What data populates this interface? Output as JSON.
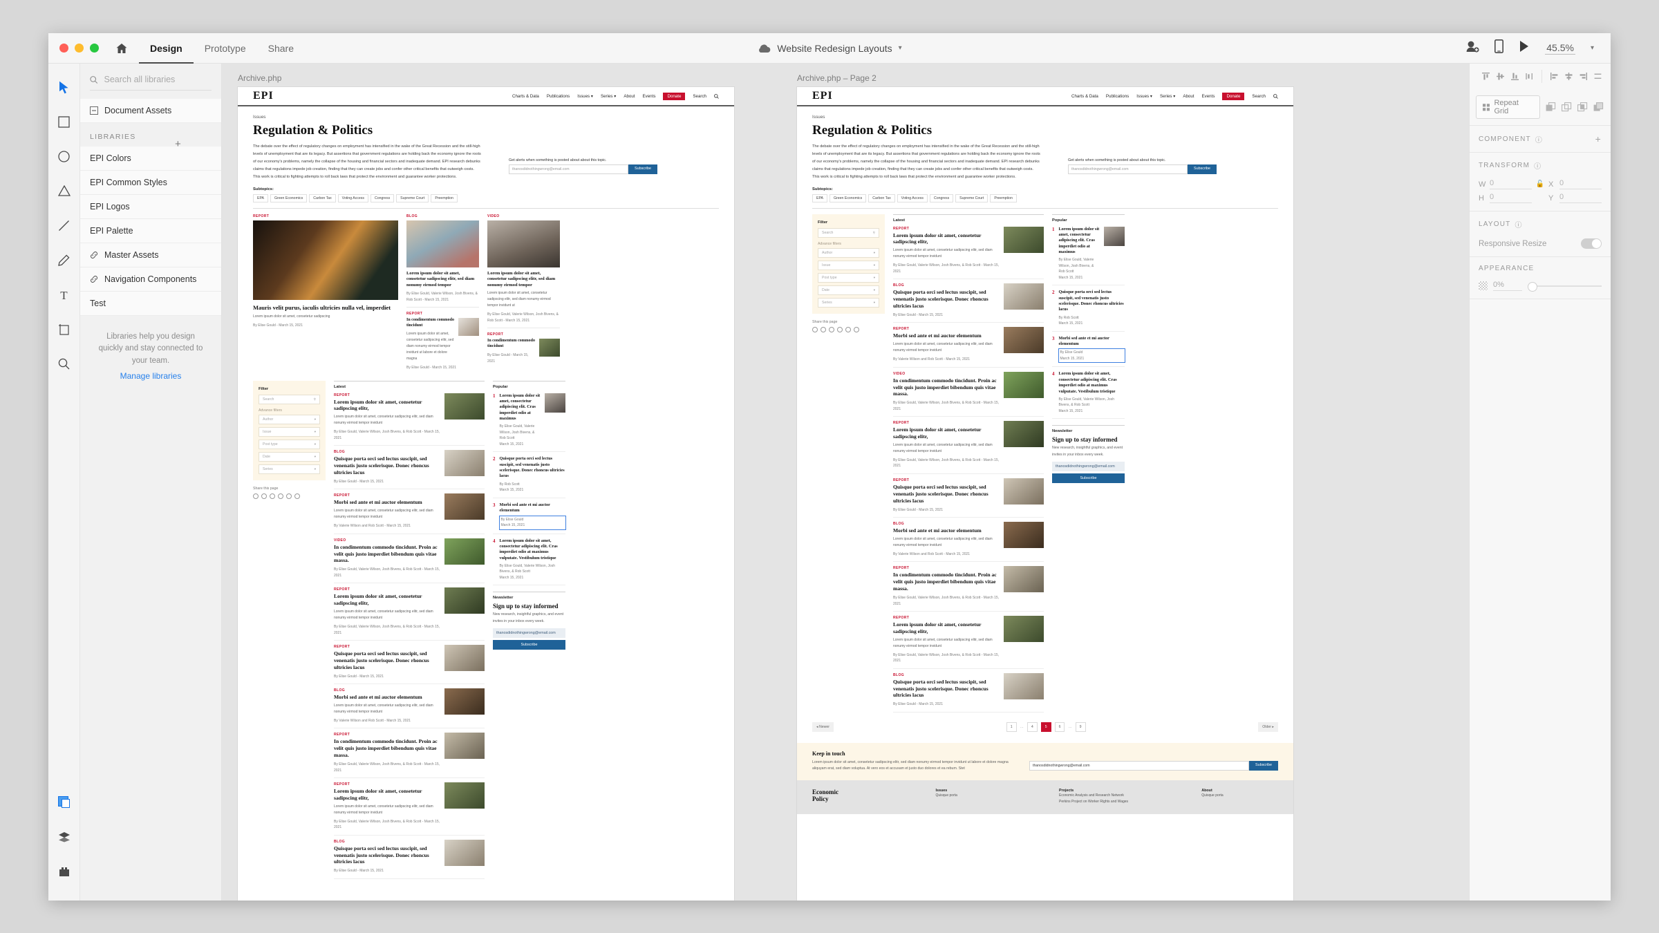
{
  "app": {
    "tabs": [
      {
        "label": "Design",
        "active": true
      },
      {
        "label": "Prototype",
        "active": false
      },
      {
        "label": "Share",
        "active": false
      }
    ],
    "document_title": "Website Redesign Layouts",
    "zoom": "45.5%",
    "home_icon": "home-icon",
    "cloud_icon": "cloud-icon",
    "share_user_icon": "add-user-icon",
    "device_preview_icon": "mobile-preview-icon",
    "play_icon": "play-icon",
    "chevron_icon": "chevron-down-icon"
  },
  "toolrail": {
    "tools": [
      {
        "name": "select-tool",
        "icon": "cursor-icon",
        "active": true
      },
      {
        "name": "rectangle-tool",
        "icon": "rectangle-icon"
      },
      {
        "name": "ellipse-tool",
        "icon": "ellipse-icon"
      },
      {
        "name": "polygon-tool",
        "icon": "triangle-icon"
      },
      {
        "name": "line-tool",
        "icon": "line-icon"
      },
      {
        "name": "pen-tool",
        "icon": "pen-icon"
      },
      {
        "name": "text-tool",
        "icon": "text-icon"
      },
      {
        "name": "artboard-tool",
        "icon": "artboard-icon"
      },
      {
        "name": "zoom-tool",
        "icon": "magnifier-icon"
      }
    ],
    "bottom": [
      {
        "name": "assets-panel",
        "icon": "assets-icon",
        "active": true
      },
      {
        "name": "layers-panel",
        "icon": "layers-icon"
      },
      {
        "name": "plugins-panel",
        "icon": "plugins-icon"
      }
    ]
  },
  "libraries": {
    "search_placeholder": "Search all libraries",
    "search_value": "",
    "document_assets": "Document Assets",
    "section_title": "LIBRARIES",
    "items": [
      {
        "label": "EPI Colors",
        "linked": false
      },
      {
        "label": "EPI Common Styles",
        "linked": false
      },
      {
        "label": "EPI Logos",
        "linked": false
      },
      {
        "label": "EPI Palette",
        "linked": false
      },
      {
        "label": "Master Assets",
        "linked": true
      },
      {
        "label": "Navigation Components",
        "linked": true
      },
      {
        "label": "Test",
        "linked": false
      }
    ],
    "hint": "Libraries help you design quickly and stay connected to your team.",
    "manage_link": "Manage libraries"
  },
  "properties": {
    "align_vertical": [
      "align-top-icon",
      "align-middle-icon",
      "align-bottom-icon",
      "distribute-vertical-icon"
    ],
    "align_horizontal": [
      "align-left-icon",
      "align-center-icon",
      "align-right-icon",
      "distribute-horizontal-icon"
    ],
    "repeat_grid_label": "Repeat Grid",
    "boolean_ops": [
      "add-icon",
      "subtract-icon",
      "intersect-icon",
      "exclude-icon"
    ],
    "component": {
      "title": "COMPONENT",
      "add": "+"
    },
    "transform": {
      "title": "TRANSFORM",
      "w_label": "W",
      "w_value": "0",
      "h_label": "H",
      "h_value": "0",
      "x_label": "X",
      "x_value": "0",
      "y_label": "Y",
      "y_value": "0",
      "lock_icon": "unlock-icon"
    },
    "layout": {
      "title": "LAYOUT",
      "responsive_label": "Responsive Resize",
      "responsive_on": true
    },
    "appearance": {
      "title": "APPEARANCE",
      "opacity": "0%"
    }
  },
  "canvas": {
    "artboards": [
      {
        "label": "Archive.php"
      },
      {
        "label": "Archive.php – Page 2"
      }
    ]
  },
  "site": {
    "logo": "EPI",
    "nav": [
      "Charts & Data",
      "Publications",
      "Issues ▾",
      "Series ▾",
      "About",
      "Events"
    ],
    "donate": "Donate",
    "search": "Search",
    "search_icon": "search-icon",
    "eyebrow": "Issues",
    "title": "Regulation & Politics",
    "intro": "The debate over the effect of regulatory changes on employment has intensified in the wake of the Great Recession and the still-high levels of unemployment that are its legacy. But assertions that government regulations are holding back the economy ignore the roots of our economy's problems, namely the collapse of the housing and financial sectors and inadequate demand. EPI research debunks claims that regulations impede job creation, finding that they can create jobs and confer other critical benefits that outweigh costs. This work is critical to fighting attempts to roll back laws that protect the environment and guarantee worker protections.",
    "subtopics_label": "Subtopics:",
    "subtopics": [
      "EPA",
      "Green Economics",
      "Carbon Tax",
      "Voting Access",
      "Congress",
      "Supreme Court",
      "Preemption"
    ],
    "alerts_label": "Get alerts when something is posted about about this topic.",
    "alerts_email": "thanosdidnothingwrong@email.com",
    "alerts_button": "Subscribe",
    "features": [
      {
        "kicker": "REPORT",
        "title": "Mauris velit purus, iaculis ultricies nulla vel, imperdiet",
        "dek": "Lorem ipsum dolor sit amet, consetetur sadipscing",
        "byline": "By Elise Gould - March 15, 2021"
      },
      {
        "kicker": "BLOG",
        "title": "Lorem ipsum dolor sit amet, consetetur sadipscing elitr, sed diam nonumy eirmod tempor",
        "byline": "By Elise Gould, Valerie Wilson, Josh Bivens, & Rob Scott - March 15, 2021"
      },
      {
        "kicker": "VIDEO",
        "title": "Lorem ipsum dolor sit amet, consetetur sadipscing elitr, sed diam nonumy eirmod tempor",
        "dek": "Lorem ipsum dolor sit amet, consetetur sadipscing elitr, sed diam nonumy eirmod tempor invidunt ut",
        "byline": "By Elise Gould, Valerie Wilson, Josh Bivens, & Rob Scott - March 15, 2021"
      }
    ],
    "sub_features": [
      {
        "kicker": "REPORT",
        "title": "In condimentum commodo tincidunt",
        "dek": "Lorem ipsum dolor sit amet, consetetur sadipscing elitr, sed diam nonumy eirmod tempor invidunt ut labore et dolore magna",
        "byline": "By Elise Gould - March 15, 2021"
      },
      {
        "kicker": "REPORT",
        "title": "In condimentum commodo tincidunt",
        "byline": "By Elise Gould - March 15, 2021"
      }
    ],
    "filter": {
      "heading": "Filter",
      "search_placeholder": "Search",
      "search_icon": "search-icon",
      "advanced_label": "Advance filters",
      "dropdowns": [
        "Author",
        "Issue",
        "Post type",
        "Date",
        "Series"
      ]
    },
    "share": {
      "label": "Share this page",
      "icons": [
        "email-icon",
        "facebook-icon",
        "globe-icon",
        "instagram-icon",
        "twitter-icon",
        "link-icon"
      ]
    },
    "latest": {
      "heading": "Latest",
      "items": [
        {
          "kicker": "REPORT",
          "title": "Lorem ipsum dolor sit amet, consetetur sadipscing elitr,",
          "dek": "Lorem ipsum dolor sit amet, consetetur sadipscing elitr, sed diam nonumy eirmod tempor invidunt",
          "byline": "By Elise Gould, Valerie Wilson, Josh Bivens, & Rob Scott - March 15, 2021"
        },
        {
          "kicker": "BLOG",
          "title": "Quisque porta orci sed lectus suscipit, sed venenatis justo scelerisque. Donec rhoncus ultricies lacus",
          "dek": "",
          "byline": "By Elise Gould - March 15, 2021"
        },
        {
          "kicker": "REPORT",
          "title": "Morbi sed ante et mi auctor elementum",
          "dek": "Lorem ipsum dolor sit amet, consetetur sadipscing elitr, sed diam nonumy eirmod tempor invidunt",
          "byline": "By Valerie Wilson and Rob Scott - March 15, 2021"
        },
        {
          "kicker": "VIDEO",
          "title": "In condimentum commodo tincidunt. Proin ac velit quis justo imperdiet bibendum quis vitae massa.",
          "dek": "",
          "byline": "By Elise Gould, Valerie Wilson, Josh Bivens, & Rob Scott - March 15, 2021"
        },
        {
          "kicker": "REPORT",
          "title": "Lorem ipsum dolor sit amet, consetetur sadipscing elitr,",
          "dek": "Lorem ipsum dolor sit amet, consetetur sadipscing elitr, sed diam nonumy eirmod tempor invidunt",
          "byline": "By Elise Gould, Valerie Wilson, Josh Bivens, & Rob Scott - March 15, 2021"
        },
        {
          "kicker": "REPORT",
          "title": "Quisque porta orci sed lectus suscipit, sed venenatis justo scelerisque. Donec rhoncus ultricies lacus",
          "dek": "",
          "byline": "By Elise Gould - March 15, 2021"
        },
        {
          "kicker": "BLOG",
          "title": "Morbi sed ante et mi auctor elementum",
          "dek": "Lorem ipsum dolor sit amet, consetetur sadipscing elitr, sed diam nonumy eirmod tempor invidunt",
          "byline": "By Valerie Wilson and Rob Scott - March 15, 2021"
        },
        {
          "kicker": "REPORT",
          "title": "In condimentum commodo tincidunt. Proin ac velit quis justo imperdiet bibendum quis vitae massa.",
          "dek": "",
          "byline": "By Elise Gould, Valerie Wilson, Josh Bivens, & Rob Scott - March 15, 2021"
        },
        {
          "kicker": "REPORT",
          "title": "Lorem ipsum dolor sit amet, consetetur sadipscing elitr,",
          "dek": "Lorem ipsum dolor sit amet, consetetur sadipscing elitr, sed diam nonumy eirmod tempor invidunt",
          "byline": "By Elise Gould, Valerie Wilson, Josh Bivens, & Rob Scott - March 15, 2021"
        },
        {
          "kicker": "BLOG",
          "title": "Quisque porta orci sed lectus suscipit, sed venenatis justo scelerisque. Donec rhoncus ultricies lacus",
          "dek": "",
          "byline": "By Elise Gould - March 15, 2021"
        }
      ]
    },
    "popular": {
      "heading": "Popular",
      "items": [
        {
          "rank": "1",
          "title": "Lorem ipsum dolor sit amet, consectetur adipiscing elit. Cras imperdiet odio at maximus",
          "byline": "By Elise Gould, Valerie Wilson, Josh Bivens, & Rob Scott",
          "date": "March 15, 2021",
          "selected": false,
          "has_thumb": true
        },
        {
          "rank": "2",
          "title": "Quisque porta orci sed lectus suscipit, sed venenatis justo scelerisque. Donec rhoncus ultricies lacus",
          "byline": "By Rob Scott",
          "date": "March 15, 2021",
          "selected": false,
          "has_thumb": false
        },
        {
          "rank": "3",
          "title": "Morbi sed ante et mi auctor elementum",
          "byline": "By Elise Gould",
          "date": "March 15, 2021",
          "selected": true,
          "has_thumb": false
        },
        {
          "rank": "4",
          "title": "Lorem ipsum dolor sit amet, consectetur adipiscing elit. Cras imperdiet odio at maximus vulputate. Vestibulum tristique",
          "byline": "By Elise Gould, Valerie Wilson, Josh Bivens, & Rob Scott",
          "date": "March 15, 2021",
          "selected": false,
          "has_thumb": false
        }
      ]
    },
    "newsletter": {
      "heading": "Newsletter",
      "title": "Sign up to stay informed",
      "body": "New research, insightful graphics, and event invites in your inbox every week.",
      "email": "thanosdidnothingwrong@email.com",
      "button": "Subscribe"
    },
    "pagination": {
      "newer": "◂ Newer",
      "pages": [
        "1",
        "…",
        "4",
        "5",
        "6",
        "…",
        "9"
      ],
      "current": "5",
      "older": "Older ▸"
    },
    "keep_in_touch": {
      "heading": "Keep in touch",
      "body": "Lorem ipsum dolor sit amet, consetetur sadipscing elitr, sed diam nonumy eirmod tempor invidunt ut labore et dolore magna aliquyam erat, sed diam voluptua. At vero eos et accusam et justo duo dolores et ea rebum. Stet",
      "email": "thanosdidnothingwrong@email.com",
      "button": "Subscribe"
    },
    "footer": {
      "logo_line1": "Economic",
      "logo_line2": "Policy",
      "columns": [
        {
          "heading": "Issues",
          "items": [
            "Quisque porta"
          ]
        },
        {
          "heading": "Projects",
          "items": [
            "Economic Analysis and Research Network",
            "Perkins Project on Worker Rights and Wages"
          ]
        },
        {
          "heading": "About",
          "items": [
            "Quisque porta"
          ]
        }
      ]
    }
  },
  "colors": {
    "donate_red": "#c8102e",
    "subscribe_blue": "#1f6298",
    "cream": "#fdf6e7",
    "selection_blue": "#3d7fe0"
  }
}
